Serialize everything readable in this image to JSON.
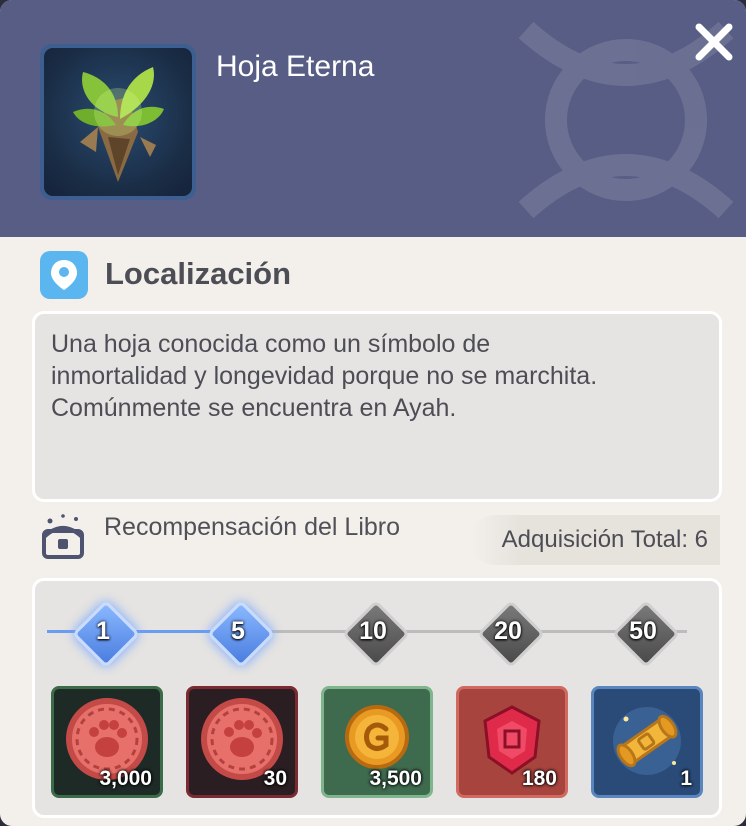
{
  "item": {
    "name": "Hoja Eterna",
    "icon": "eternal-leaf-icon"
  },
  "close_icon": "close-icon",
  "location": {
    "title": "Localización",
    "icon": "location-pin-icon",
    "description_lines": [
      "Una hoja conocida como un símbolo de",
      "inmortalidad y longevidad porque no se marchita.",
      "Comúnmente se encuentra en Ayah."
    ]
  },
  "rewards": {
    "title": "Recompensación del Libro",
    "icon": "treasure-chest-icon",
    "total_label": "Adquisición Total: 6",
    "milestones": [
      {
        "value": "1",
        "reached": true
      },
      {
        "value": "5",
        "reached": true
      },
      {
        "value": "10",
        "reached": false
      },
      {
        "value": "20",
        "reached": false
      },
      {
        "value": "50",
        "reached": false
      }
    ],
    "items": [
      {
        "icon": "red-paw-token-icon",
        "quantity": "3,000"
      },
      {
        "icon": "red-paw-token-icon",
        "quantity": "30"
      },
      {
        "icon": "gold-coin-icon",
        "quantity": "3,500"
      },
      {
        "icon": "red-gem-icon",
        "quantity": "180"
      },
      {
        "icon": "golden-scroll-icon",
        "quantity": "1"
      }
    ]
  },
  "colors": {
    "header": "#575d85",
    "panel": "#f3f0ec",
    "accent_blue": "#5bb6ef",
    "milestone_active": "#4a7de0"
  }
}
